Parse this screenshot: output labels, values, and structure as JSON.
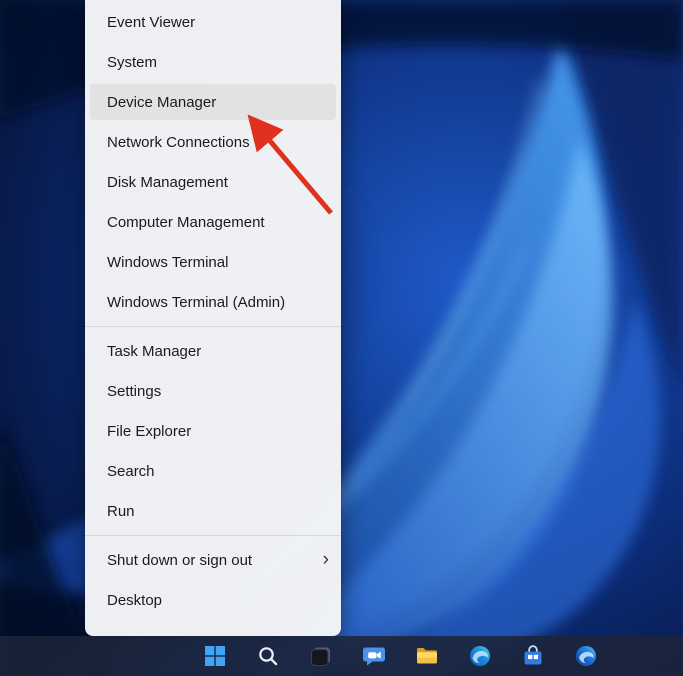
{
  "menu": {
    "chevron": "›",
    "groups": [
      {
        "items": [
          {
            "label": "Event Viewer"
          },
          {
            "label": "System"
          },
          {
            "label": "Device Manager",
            "highlighted": true
          },
          {
            "label": "Network Connections"
          },
          {
            "label": "Disk Management"
          },
          {
            "label": "Computer Management"
          },
          {
            "label": "Windows Terminal"
          },
          {
            "label": "Windows Terminal (Admin)"
          }
        ]
      },
      {
        "items": [
          {
            "label": "Task Manager"
          },
          {
            "label": "Settings"
          },
          {
            "label": "File Explorer"
          },
          {
            "label": "Search"
          },
          {
            "label": "Run"
          }
        ]
      },
      {
        "items": [
          {
            "label": "Shut down or sign out",
            "has_submenu": true
          },
          {
            "label": "Desktop"
          }
        ]
      }
    ]
  },
  "annotation": {
    "type": "arrow",
    "points_to": "Device Manager",
    "color": "#e0301e"
  },
  "taskbar": {
    "icons": [
      {
        "name": "start"
      },
      {
        "name": "search"
      },
      {
        "name": "task-view"
      },
      {
        "name": "chat"
      },
      {
        "name": "file-explorer"
      },
      {
        "name": "edge"
      },
      {
        "name": "store"
      },
      {
        "name": "browser"
      }
    ]
  },
  "colors": {
    "menu_background": "#f3f4f6",
    "menu_highlight": "#e2e2e2",
    "taskbar_background": "#1c243a",
    "arrow_red": "#e0301e",
    "wallpaper_blue": "#2e7de8"
  }
}
